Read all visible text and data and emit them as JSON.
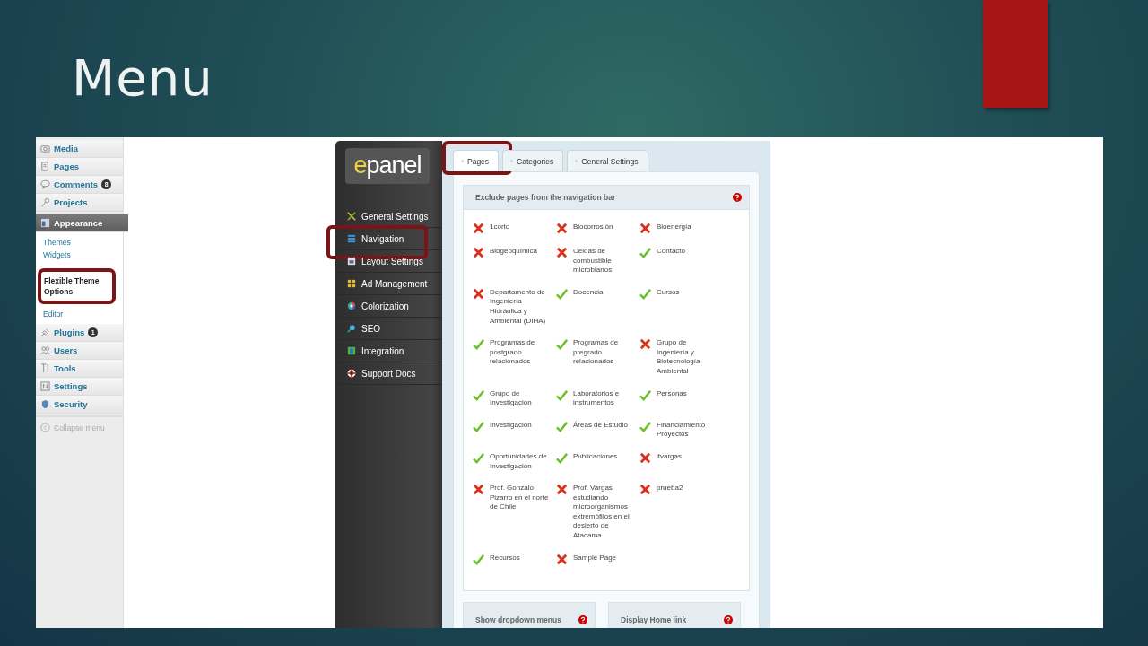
{
  "slide": {
    "title": "Menu"
  },
  "wp_menu": {
    "items": [
      {
        "label": "Media",
        "kind": "media",
        "selected": false
      },
      {
        "label": "Pages",
        "kind": "pages",
        "selected": false
      },
      {
        "label": "Comments",
        "kind": "comments",
        "badge": "8",
        "selected": false
      },
      {
        "label": "Projects",
        "kind": "projects",
        "selected": false
      },
      {
        "label": "Appearance",
        "kind": "appearance",
        "selected": true,
        "submenu": [
          "Themes",
          "Widgets"
        ],
        "callout": "Flexible Theme Options",
        "submenu_after": [
          "Editor"
        ]
      },
      {
        "label": "Plugins",
        "kind": "plugins",
        "badge": "1",
        "selected": false
      },
      {
        "label": "Users",
        "kind": "users",
        "selected": false
      },
      {
        "label": "Tools",
        "kind": "tools",
        "selected": false
      },
      {
        "label": "Settings",
        "kind": "settings",
        "selected": false
      },
      {
        "label": "Security",
        "kind": "security",
        "selected": false
      }
    ],
    "collapse": "Collapse menu"
  },
  "epanel": {
    "logo": "epanel",
    "nav": [
      {
        "label": "General Settings",
        "kind": "general",
        "highlighted": false
      },
      {
        "label": "Navigation",
        "kind": "navigation",
        "highlighted": true
      },
      {
        "label": "Layout Settings",
        "kind": "layout",
        "highlighted": false
      },
      {
        "label": "Ad Management",
        "kind": "ads",
        "highlighted": false
      },
      {
        "label": "Colorization",
        "kind": "color",
        "highlighted": false
      },
      {
        "label": "SEO",
        "kind": "seo",
        "highlighted": false
      },
      {
        "label": "Integration",
        "kind": "integration",
        "highlighted": false
      },
      {
        "label": "Support Docs",
        "kind": "support",
        "highlighted": false
      }
    ],
    "tabs": [
      {
        "label": "Pages",
        "selected": true,
        "highlighted": true
      },
      {
        "label": "Categories",
        "selected": false,
        "highlighted": false
      },
      {
        "label": "General Settings",
        "selected": false,
        "highlighted": false
      }
    ],
    "exclude": {
      "title": "Exclude pages from the navigation bar",
      "pages": [
        {
          "label": "1corto",
          "checked": false
        },
        {
          "label": "Biocorrosión",
          "checked": false
        },
        {
          "label": "Bioenergía",
          "checked": false
        },
        {
          "label": "Biogeoquímica",
          "checked": false
        },
        {
          "label": "Celdas de combustible microbianos",
          "checked": false
        },
        {
          "label": "Contacto",
          "checked": true
        },
        {
          "label": "Departamento de Ingeniería Hidráulica y Ambiental (DIHA)",
          "checked": false
        },
        {
          "label": "Docencia",
          "checked": true
        },
        {
          "label": "Cursos",
          "checked": true
        },
        {
          "label": "Programas de postgrado relacionados",
          "checked": true
        },
        {
          "label": "Programas de pregrado relacionados",
          "checked": true
        },
        {
          "label": "Grupo de Ingeniería y Biotecnología Ambiental",
          "checked": false
        },
        {
          "label": "Grupo de Investigación",
          "checked": true
        },
        {
          "label": "Laboratorios e instrumentos",
          "checked": true
        },
        {
          "label": "Personas",
          "checked": true
        },
        {
          "label": "Investigación",
          "checked": true
        },
        {
          "label": "Áreas de Estudio",
          "checked": true
        },
        {
          "label": "Financiamiento Proyectos",
          "checked": true
        },
        {
          "label": "Oportunidades de Investigación",
          "checked": true
        },
        {
          "label": "Publicaciones",
          "checked": true
        },
        {
          "label": "itvargas",
          "checked": false
        },
        {
          "label": "Prof. Gonzalo Pizarro en el norte de Chile",
          "checked": false
        },
        {
          "label": "Prof. Vargas estudiando microorganismos extremófilos en el desierto de Atacama",
          "checked": false
        },
        {
          "label": "prueba2",
          "checked": false
        },
        {
          "label": "Recursos",
          "checked": true
        },
        {
          "label": "Sample Page",
          "checked": false
        }
      ]
    },
    "sections": [
      "Show dropdown menus",
      "Display Home link"
    ]
  }
}
